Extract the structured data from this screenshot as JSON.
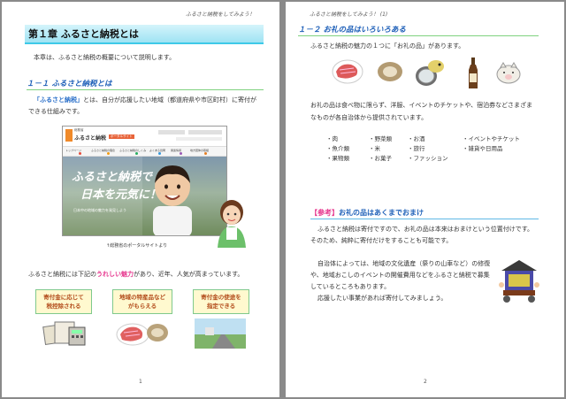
{
  "running_header": "ふるさと納税をしてみよう！",
  "running_header_p2": "ふるさと納税をしてみよう！ (1)",
  "page1": {
    "chapter_title": "第１章 ふるさと納税とは",
    "intro": "本章は、ふるさと納税の概要について説明します。",
    "section_title": "１－１ ふるさと納税とは",
    "def_term": "「ふるさと納税」",
    "def_rest_1": "とは、自分が応援したい地域（都道府県や市区町村）に寄付が",
    "def_rest_2": "できる仕組みです。",
    "screenshot": {
      "logo_small": "総務省",
      "logo_main": "ふるさと納税",
      "logo_badge": "ポータルサイト",
      "nav": [
        "トップページ",
        "ふるさと納税の理念",
        "ふるさと納税のしくみ",
        "よくある質問",
        "関連情報",
        "地方団体の取組"
      ],
      "hero_line1": "ふるさと納税で",
      "hero_line2": "日本を元気に！",
      "hero_sub": "日本中の地域の魅力を発見しよう"
    },
    "caption": "↑総務省のポータルサイトより",
    "appeal_pre": "ふるさと納税には下記の",
    "appeal_hl": "うれしい魅力",
    "appeal_post": "があり、近年、人気が高まっています。",
    "benefits": [
      "寄付金に応じて\n税控除される",
      "地域の特産品など\nがもらえる",
      "寄付金の使途を\n指定できる"
    ],
    "page_number": "1"
  },
  "page2": {
    "section_title": "１－２ お礼の品はいろいろある",
    "intro": "ふるさと納税の魅力の１つに「お礼の品」があります。",
    "body_1": "お礼の品は食べ物に限らず、洋服、イベントのチケットや、宿泊券などさまざま",
    "body_2": "なものが各自治体から提供されています。",
    "categories": [
      "・肉",
      "・野菜類",
      "・お酒",
      "・イベントやチケット",
      "・魚介類",
      "・米",
      "・旅行",
      "・雑貨や日用品",
      "・果物類",
      "・お菓子",
      "・ファッション"
    ],
    "ref_tag": "【参考】",
    "ref_title": "お礼の品はあくまでおまけ",
    "ref_1": "ふるさと納税は寄付ですので、お礼の品は本来はおまけという位置付けです。",
    "ref_2": "そのため、純粋に寄付だけをすることも可能です。",
    "ref_3": "自治体によっては、地域の文化遺産（祭りの山車など）の修復",
    "ref_4": "や、地域おこしのイベントの開催費用などをふるさと納税で募集",
    "ref_5": "しているところもあります。",
    "ref_6": "応援したい事業があれば寄付してみましょう。",
    "page_number": "2"
  },
  "icons": [
    "meat-icon",
    "oyster-icon",
    "pufferfish-plate-icon",
    "sake-bottle-icon",
    "piggy-bank-icon",
    "tax-documents-icon",
    "festival-float-icon",
    "person-icon"
  ],
  "colors": {
    "heading_blue": "#1d5fb8",
    "accent_pink": "#e6358d",
    "banner_cyan": "#9fe3f3",
    "category_green": "#29a04a"
  }
}
